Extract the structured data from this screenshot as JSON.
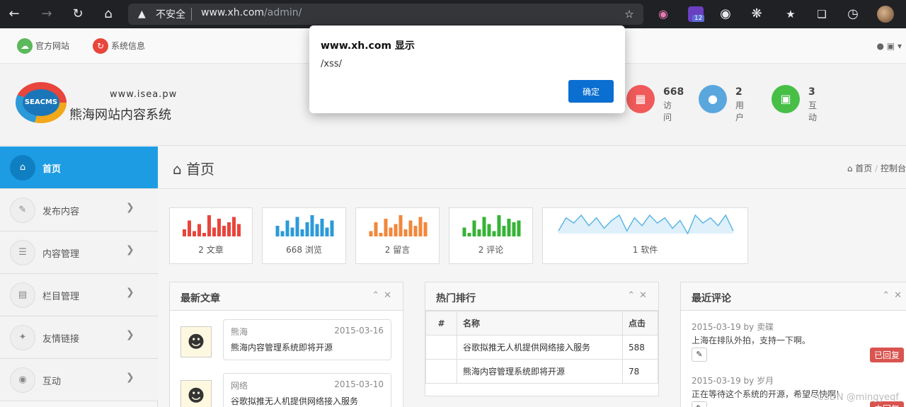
{
  "browser": {
    "insecure_label": "不安全",
    "url_host": "www.xh.com",
    "url_path": "/admin/",
    "ext_badge": "12"
  },
  "topbar": {
    "official_site": "官方网站",
    "system_info": "系统信息"
  },
  "header": {
    "logo_text": "SEACMS",
    "logo_url": "www.isea.pw",
    "logo_title": "熊海网站内容系统",
    "stats": [
      {
        "num": "668",
        "label": "访问",
        "color": "#f05a5a"
      },
      {
        "num": "2",
        "label": "用户",
        "color": "#5aa7de"
      },
      {
        "num": "3",
        "label": "互动",
        "color": "#47bf47"
      }
    ]
  },
  "sidebar": {
    "items": [
      {
        "label": "首页"
      },
      {
        "label": "发布内容"
      },
      {
        "label": "内容管理"
      },
      {
        "label": "栏目管理"
      },
      {
        "label": "友情链接"
      },
      {
        "label": "互动"
      }
    ]
  },
  "page": {
    "title": "首页",
    "crumb_home": "首页",
    "crumb_sep": "/",
    "crumb_current": "控制台"
  },
  "tiles": [
    {
      "label": "2 文章",
      "color": "#e8453c",
      "values": [
        4,
        9,
        3,
        7,
        2,
        12,
        5,
        10,
        6,
        8,
        11,
        7
      ]
    },
    {
      "label": "668 浏览",
      "color": "#2c9ad8",
      "values": [
        6,
        3,
        9,
        5,
        11,
        4,
        8,
        12,
        7,
        10,
        5,
        9
      ]
    },
    {
      "label": "2 留言",
      "color": "#f2873b",
      "values": [
        3,
        8,
        2,
        10,
        5,
        7,
        12,
        4,
        9,
        6,
        11,
        8
      ]
    },
    {
      "label": "2 评论",
      "color": "#36b336",
      "values": [
        5,
        2,
        9,
        4,
        11,
        7,
        3,
        12,
        6,
        10,
        8,
        9
      ]
    },
    {
      "label": "1 软件",
      "color": "#5fb6e3",
      "values": [
        3,
        8,
        6,
        9,
        5,
        8,
        4,
        7,
        9,
        3,
        8,
        5,
        9,
        6,
        8,
        4,
        7,
        2,
        9,
        6,
        8,
        5,
        9,
        3
      ]
    }
  ],
  "latest": {
    "title": "最新文章",
    "items": [
      {
        "author": "熊海",
        "date": "2015-03-16",
        "title": "熊海内容管理系统即将开源"
      },
      {
        "author": "网络",
        "date": "2015-03-10",
        "title": "谷歌拟推无人机提供网络接入服务"
      }
    ]
  },
  "hot": {
    "title": "热门排行",
    "col_num": "#",
    "col_name": "名称",
    "col_clicks": "点击",
    "rows": [
      {
        "name": "谷歌拟推无人机提供网络接入服务",
        "clicks": "588"
      },
      {
        "name": "熊海内容管理系统即将开源",
        "clicks": "78"
      }
    ]
  },
  "comments": {
    "title": "最近评论",
    "items": [
      {
        "meta": "2015-03-19 by 卖碟",
        "text": "上海在排队外拍，支持一下啊。",
        "status": "已回复"
      },
      {
        "meta": "2015-03-19 by 岁月",
        "text": "正在等待这个系统的开源，希望尽快啊!",
        "status": "未回复"
      }
    ]
  },
  "dialog": {
    "title": "www.xh.com 显示",
    "message": "/xss/",
    "ok": "确定"
  },
  "watermark": "CSDN @mingyeqf"
}
